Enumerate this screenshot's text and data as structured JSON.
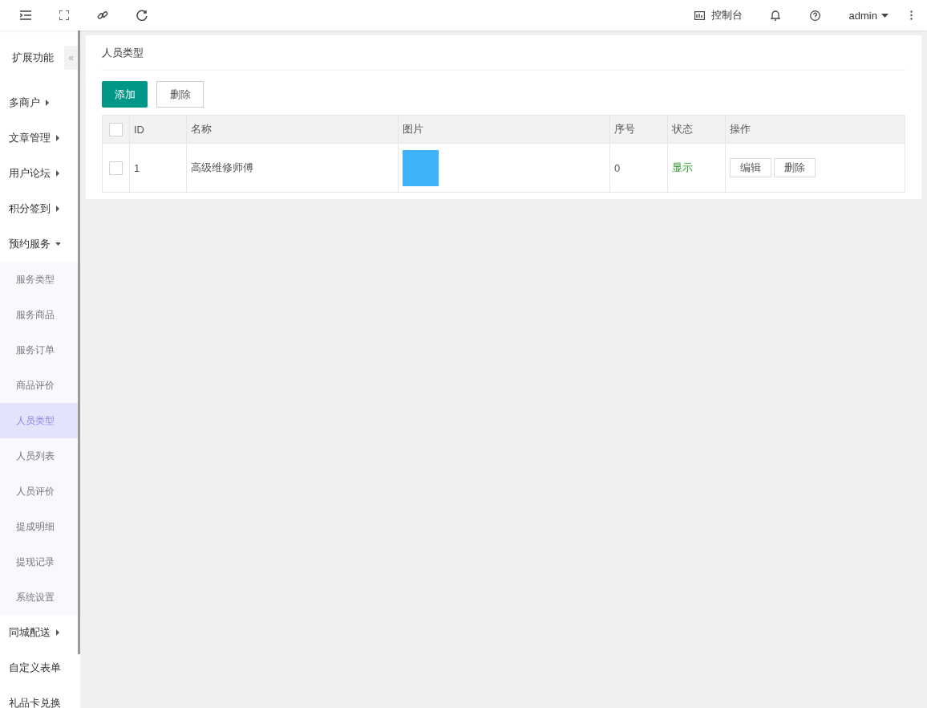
{
  "topbar": {
    "console": "控制台",
    "user": "admin"
  },
  "sidebar": {
    "title": "扩展功能",
    "collapse": "«",
    "items": [
      {
        "label": "多商户",
        "expanded": false
      },
      {
        "label": "文章管理",
        "expanded": false
      },
      {
        "label": "用户论坛",
        "expanded": false
      },
      {
        "label": "积分签到",
        "expanded": false
      },
      {
        "label": "预约服务",
        "expanded": true,
        "children": [
          {
            "label": "服务类型",
            "selected": false
          },
          {
            "label": "服务商品",
            "selected": false
          },
          {
            "label": "服务订单",
            "selected": false
          },
          {
            "label": "商品评价",
            "selected": false
          },
          {
            "label": "人员类型",
            "selected": true
          },
          {
            "label": "人员列表",
            "selected": false
          },
          {
            "label": "人员评价",
            "selected": false
          },
          {
            "label": "提成明细",
            "selected": false
          },
          {
            "label": "提现记录",
            "selected": false
          },
          {
            "label": "系统设置",
            "selected": false
          }
        ]
      },
      {
        "label": "同城配送",
        "expanded": false
      },
      {
        "label": "自定义表单"
      },
      {
        "label": "礼品卡兑换"
      }
    ]
  },
  "page": {
    "title": "人员类型",
    "buttons": {
      "add": "添加",
      "delete": "删除"
    },
    "table": {
      "all_checked": false,
      "columns": [
        "ID",
        "名称",
        "图片",
        "序号",
        "状态",
        "操作"
      ],
      "rows": [
        {
          "checked": false,
          "id": "1",
          "name": "高级维修师傅",
          "sort": "0",
          "status": "显示",
          "actions": [
            "编辑",
            "删除"
          ]
        }
      ]
    }
  }
}
